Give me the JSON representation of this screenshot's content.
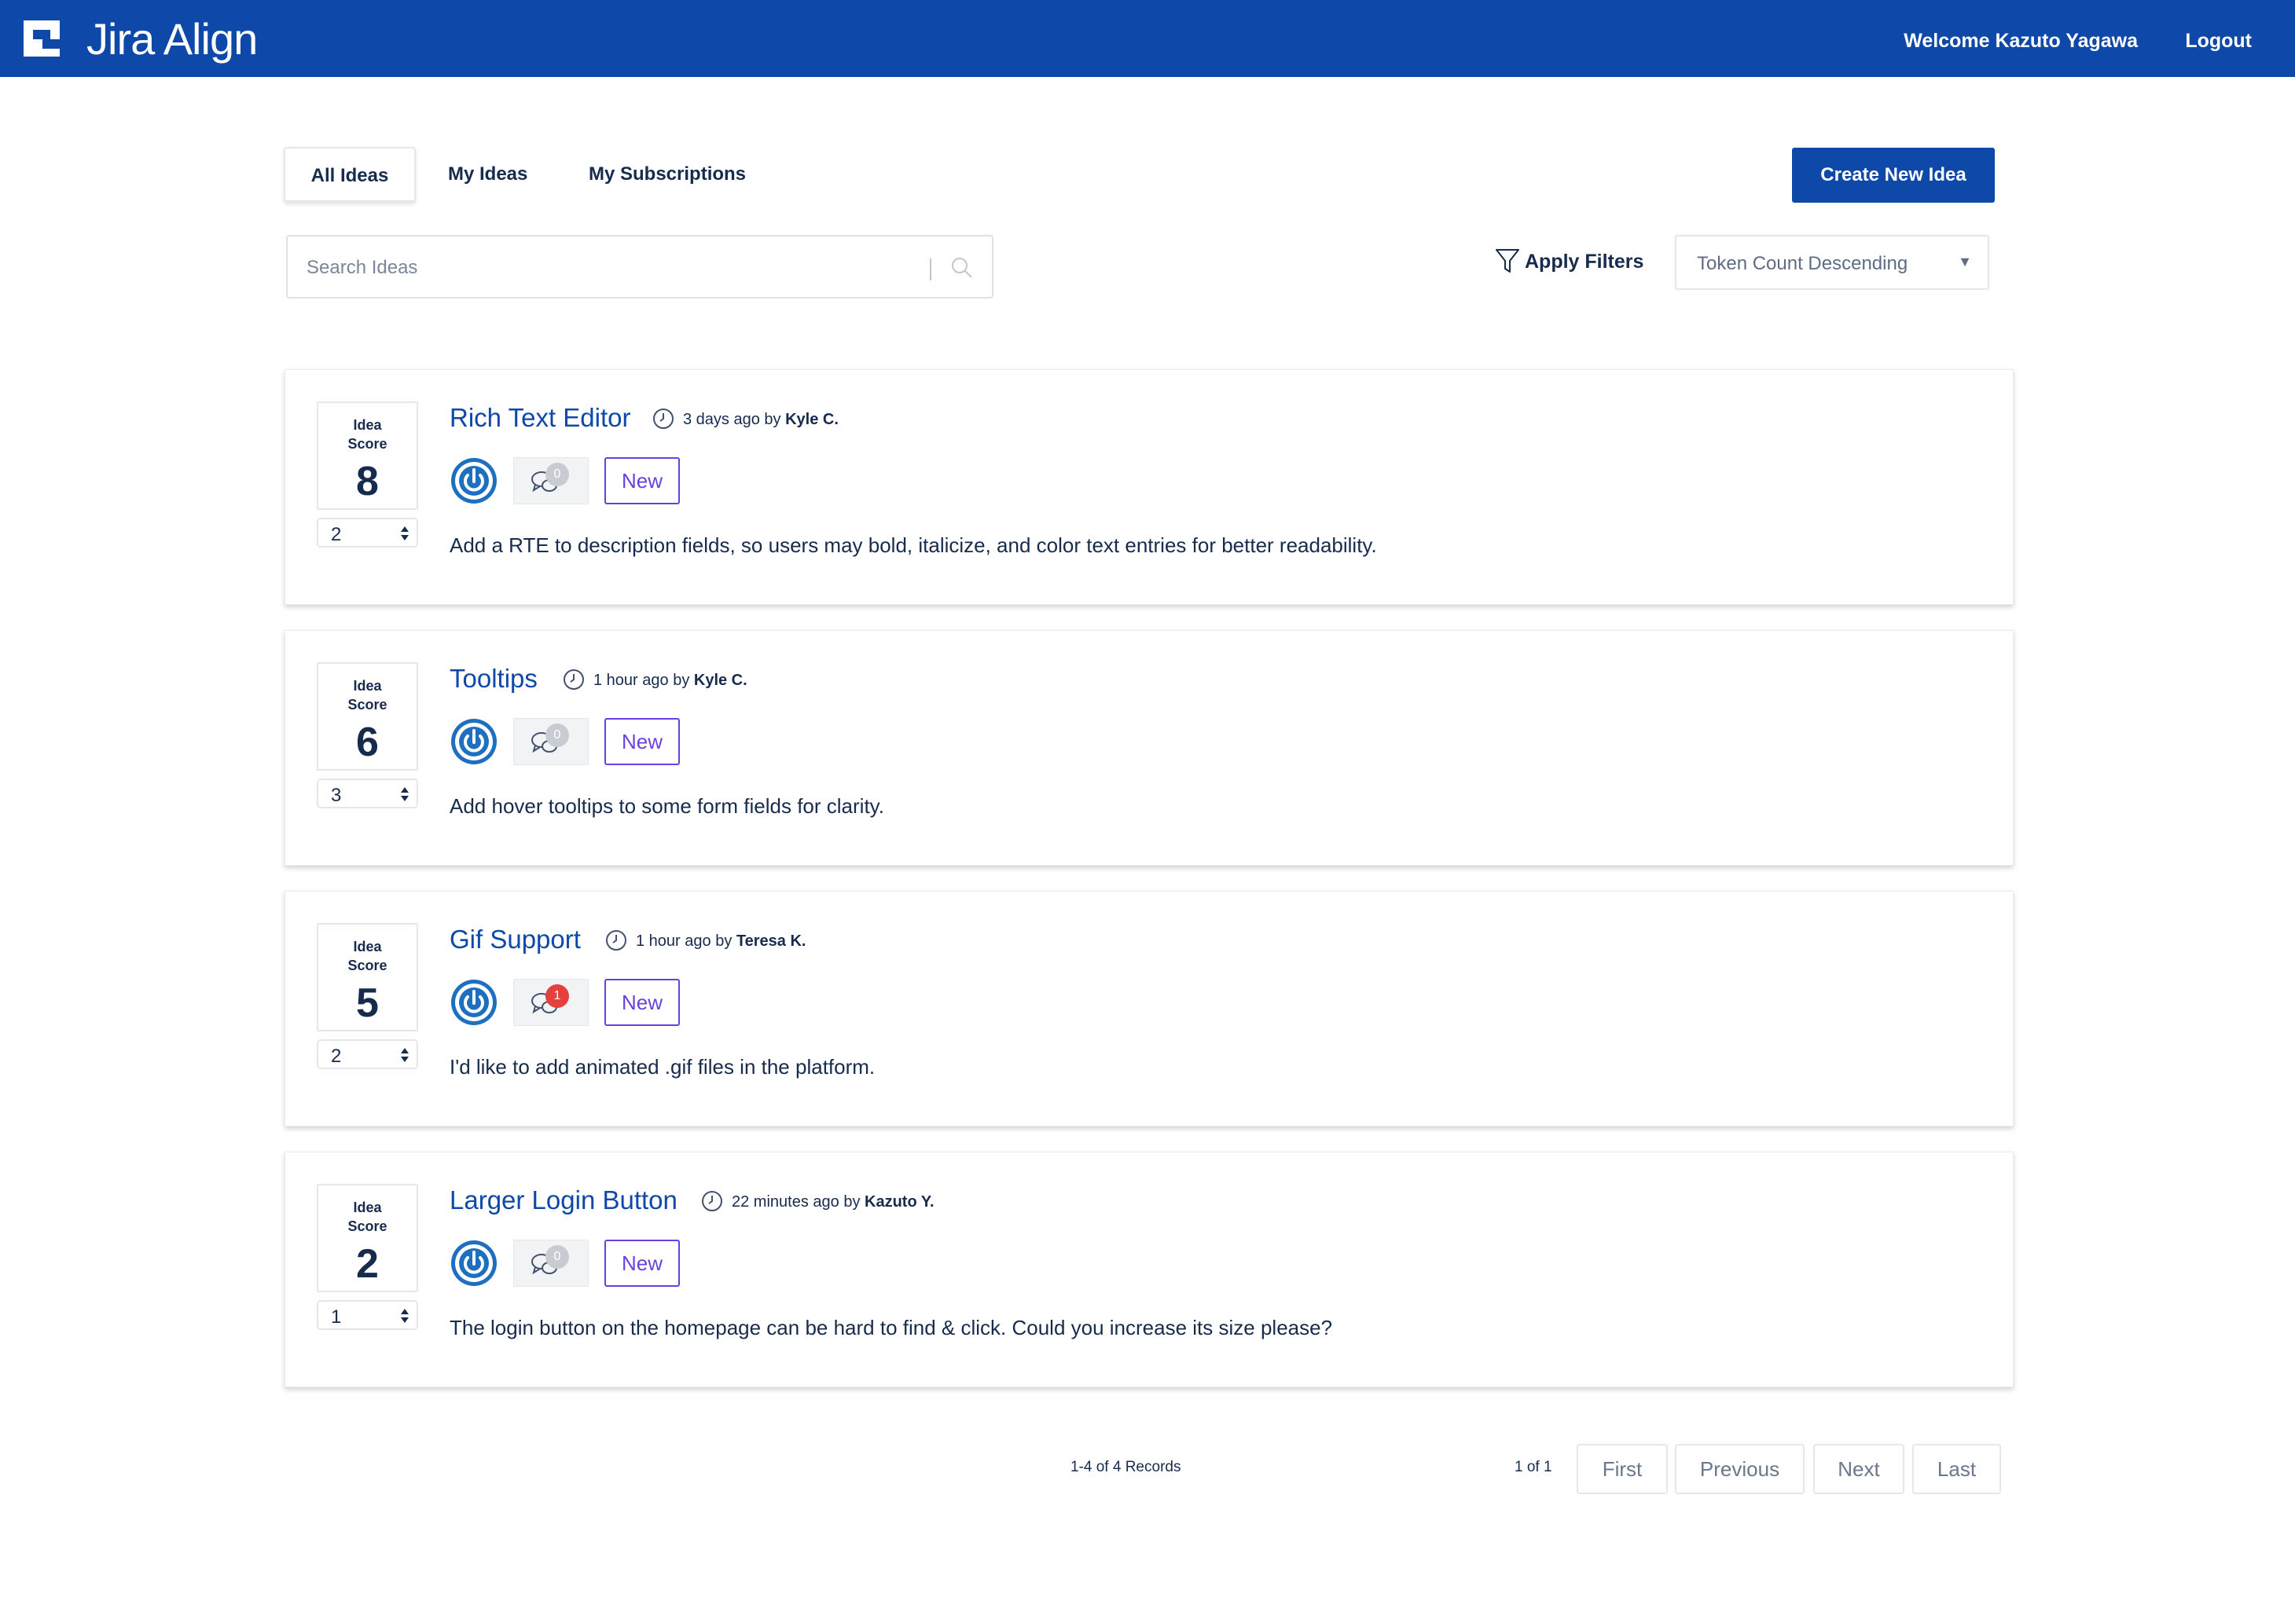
{
  "header": {
    "brand": "Jira Align",
    "welcome": "Welcome Kazuto Yagawa",
    "logout": "Logout",
    "bar_color": "#0e48a8"
  },
  "tabs": [
    {
      "label": "All Ideas",
      "active": true
    },
    {
      "label": "My Ideas",
      "active": false
    },
    {
      "label": "My Subscriptions",
      "active": false
    }
  ],
  "create_button": "Create New Idea",
  "search": {
    "placeholder": "Search Ideas",
    "value": ""
  },
  "filters_label": "Apply Filters",
  "sort": {
    "selected": "Token Count Descending"
  },
  "score_label_1": "Idea",
  "score_label_2": "Score",
  "ideas": [
    {
      "title": "Rich Text Editor",
      "time": "3 days ago by ",
      "author": "Kyle C.",
      "score": "8",
      "tokens": "2",
      "comments": "0",
      "status": "New",
      "description": "Add a RTE to description fields, so users may bold, italicize, and color text entries for better readability."
    },
    {
      "title": "Tooltips",
      "time": "1 hour ago by ",
      "author": "Kyle C.",
      "score": "6",
      "tokens": "3",
      "comments": "0",
      "status": "New",
      "description": "Add hover tooltips to some form fields for clarity."
    },
    {
      "title": "Gif Support",
      "time": "1 hour ago by ",
      "author": "Teresa K.",
      "score": "5",
      "tokens": "2",
      "comments": "1",
      "status": "New",
      "description": "I'd like to add animated .gif files in the platform."
    },
    {
      "title": "Larger Login Button",
      "time": "22 minutes ago by ",
      "author": "Kazuto Y.",
      "score": "2",
      "tokens": "1",
      "comments": "0",
      "status": "New",
      "description": "The login button on the homepage can be hard to find & click. Could you increase its size please?"
    }
  ],
  "footer": {
    "records": "1-4 of 4 Records",
    "page": "1 of 1",
    "first": "First",
    "previous": "Previous",
    "next": "Next",
    "last": "Last"
  },
  "colors": {
    "accent": "#0e48a8",
    "status_new": "#6b40e0",
    "badge_unread": "#e5403c",
    "badge_read": "#c8ccd2"
  }
}
